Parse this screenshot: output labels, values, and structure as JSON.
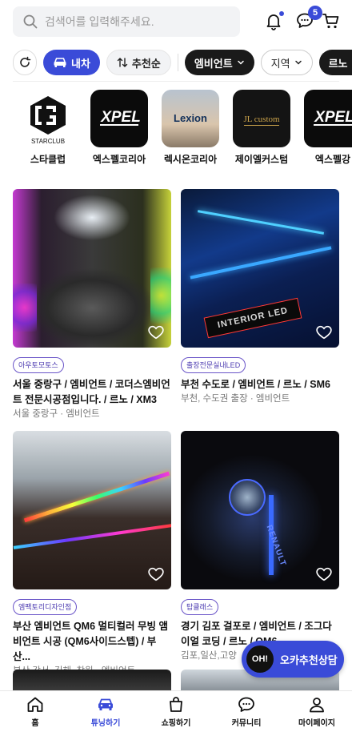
{
  "search": {
    "placeholder": "검색어를 입력해주세요."
  },
  "header": {
    "chat_badge": "5"
  },
  "filters": {
    "mycar": "내차",
    "sort": "추천순",
    "category": "엠비언트",
    "region": "지역",
    "brand": "르노"
  },
  "shops": [
    {
      "name": "스타클럽",
      "logo_text": "STARCLUB"
    },
    {
      "name": "엑스펠코리아",
      "logo_text": "XPEL"
    },
    {
      "name": "렉시온코리아",
      "logo_text": "Lexion"
    },
    {
      "name": "제이엘커스텀",
      "logo_text": "JL custom"
    },
    {
      "name": "엑스펠강",
      "logo_text": "XPEL"
    }
  ],
  "cards": [
    {
      "tag": "아우토모토스",
      "title": "서울 중랑구 / 엠비언트 / 코더스엠비언트 전문시공점입니다. / 르노 / XM3",
      "sub": "서울 중랑구 · 엠비언트"
    },
    {
      "tag": "출장전문실내LED",
      "title": "부천 수도로 / 엠비언트 / 르노 / SM6",
      "sub": "부천, 수도권 출장 · 엠비언트",
      "img_text": "INTERIOR LED"
    },
    {
      "tag": "엠팩토리디자인점",
      "title": "부산 엠비언트 QM6 멀티컬러 무빙 앰비언트 시공 (QM6사이드스텝) / 부산...",
      "sub": "부산 강서, 김해, 창원 · 엠비언트"
    },
    {
      "tag": "탑클래스",
      "title": "경기 김포 걸포로 / 엠비언트 / 조그다이얼 코딩 / 르노 / QM6",
      "sub": "김포,일산,고양",
      "img_text": "RENAULT"
    }
  ],
  "fab": {
    "circle": "OH!",
    "label": "오카추천상담"
  },
  "nav": [
    {
      "label": "홈",
      "icon": "home-icon"
    },
    {
      "label": "튜닝하기",
      "icon": "car-icon",
      "active": true
    },
    {
      "label": "쇼핑하기",
      "icon": "shopping-bag-icon"
    },
    {
      "label": "커뮤니티",
      "icon": "chat-icon"
    },
    {
      "label": "마이페이지",
      "icon": "person-icon"
    }
  ],
  "colors": {
    "accent": "#3a4bd8",
    "tag_border": "#6a55c8",
    "dark_chip": "#1a1a1a"
  }
}
